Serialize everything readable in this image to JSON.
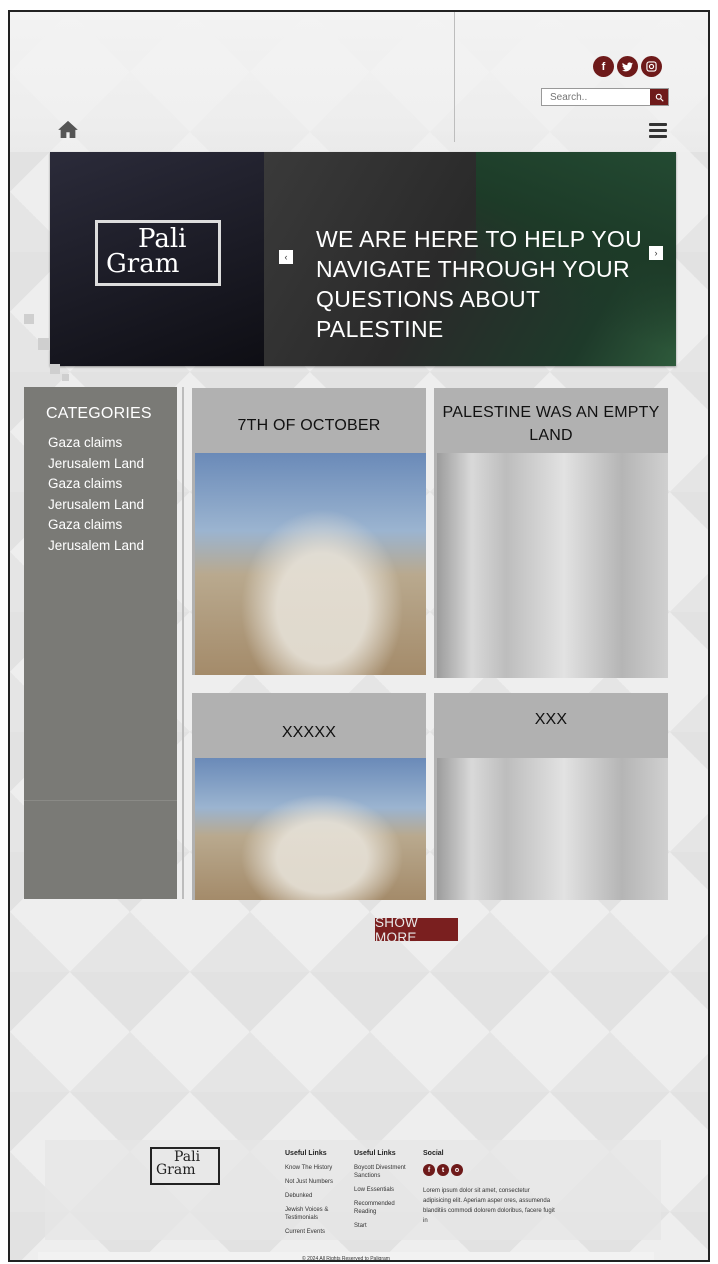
{
  "header": {
    "social_icons": [
      "facebook-icon",
      "twitter-icon",
      "instagram-icon"
    ],
    "search_placeholder": "Search..",
    "brand_color": "#6e1a1a"
  },
  "hero": {
    "logo_line1": "Pali",
    "logo_line2": "Gram",
    "headline": "WE ARE HERE TO HELP YOU NAVIGATE THROUGH YOUR QUESTIONS ABOUT PALESTINE",
    "prev_label": "‹",
    "next_label": "›"
  },
  "sidebar": {
    "title": "CATEGORIES",
    "items": [
      "Gaza claims",
      "Jerusalem Land",
      "Gaza claims",
      "Jerusalem Land",
      "Gaza claims",
      "Jerusalem Land"
    ]
  },
  "cards": [
    {
      "title": "7TH OF OCTOBER",
      "image": "bulldozer-border-photo"
    },
    {
      "title": "PALESTINE WAS AN EMPTY LAND",
      "image": "historic-street-photo"
    },
    {
      "title": "XXXXX",
      "image": "bulldozer-border-photo"
    },
    {
      "title": "XXX",
      "image": "historic-street-photo"
    }
  ],
  "show_more_label": "SHOW MORE",
  "footer": {
    "logo_line1": "Pali",
    "logo_line2": "Gram",
    "col1_title": "Useful Links",
    "col1_items": [
      "Know The History",
      "Not Just Numbers",
      "Debunked",
      "Jewish Voices & Testimonials",
      "Current Events"
    ],
    "col2_title": "Useful Links",
    "col2_items": [
      "Boycott Divestment Sanctions",
      "Low Essentials",
      "Recommended Reading",
      "Start"
    ],
    "social_title": "Social",
    "social_text": "Lorem ipsum dolor sit amet, consectetur adipisicing elit. Aperiam asper ores, assumenda blanditiis commodi dolorem doloribus, facere fugit in",
    "copyright": "© 2024 All Rights Reserved to Paligram"
  }
}
